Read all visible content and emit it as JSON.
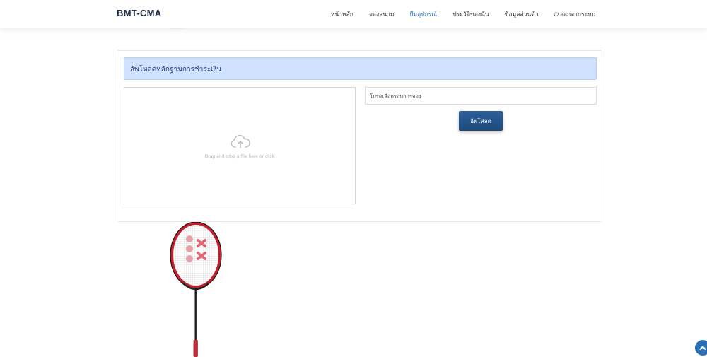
{
  "brand": "BMT-CMA",
  "nav": {
    "items": [
      {
        "label": "หน้าหลัก"
      },
      {
        "label": "จองสนาม"
      },
      {
        "label": "ยืมอุปกรณ์"
      },
      {
        "label": "ประวัติของฉัน"
      },
      {
        "label": "ข้อมูลส่วนตัว"
      },
      {
        "label": "ออกจากระบบ"
      }
    ],
    "active_index": 2
  },
  "card": {
    "title": "อัพโหลดหลักฐานการชำระเงิน",
    "dropzone_text": "Drag and drop a file here or click",
    "select_placeholder": "โปรดเลือกรอบการจอง",
    "upload_label": "อัพโหลด"
  },
  "icons": {
    "upload": "cloud-upload-icon",
    "logout": "power-icon",
    "scroll_top": "chevron-up-icon"
  },
  "colors": {
    "accent": "#2b6fb6",
    "header_bg": "#cfe2ff",
    "button": "#1e4a7b"
  }
}
